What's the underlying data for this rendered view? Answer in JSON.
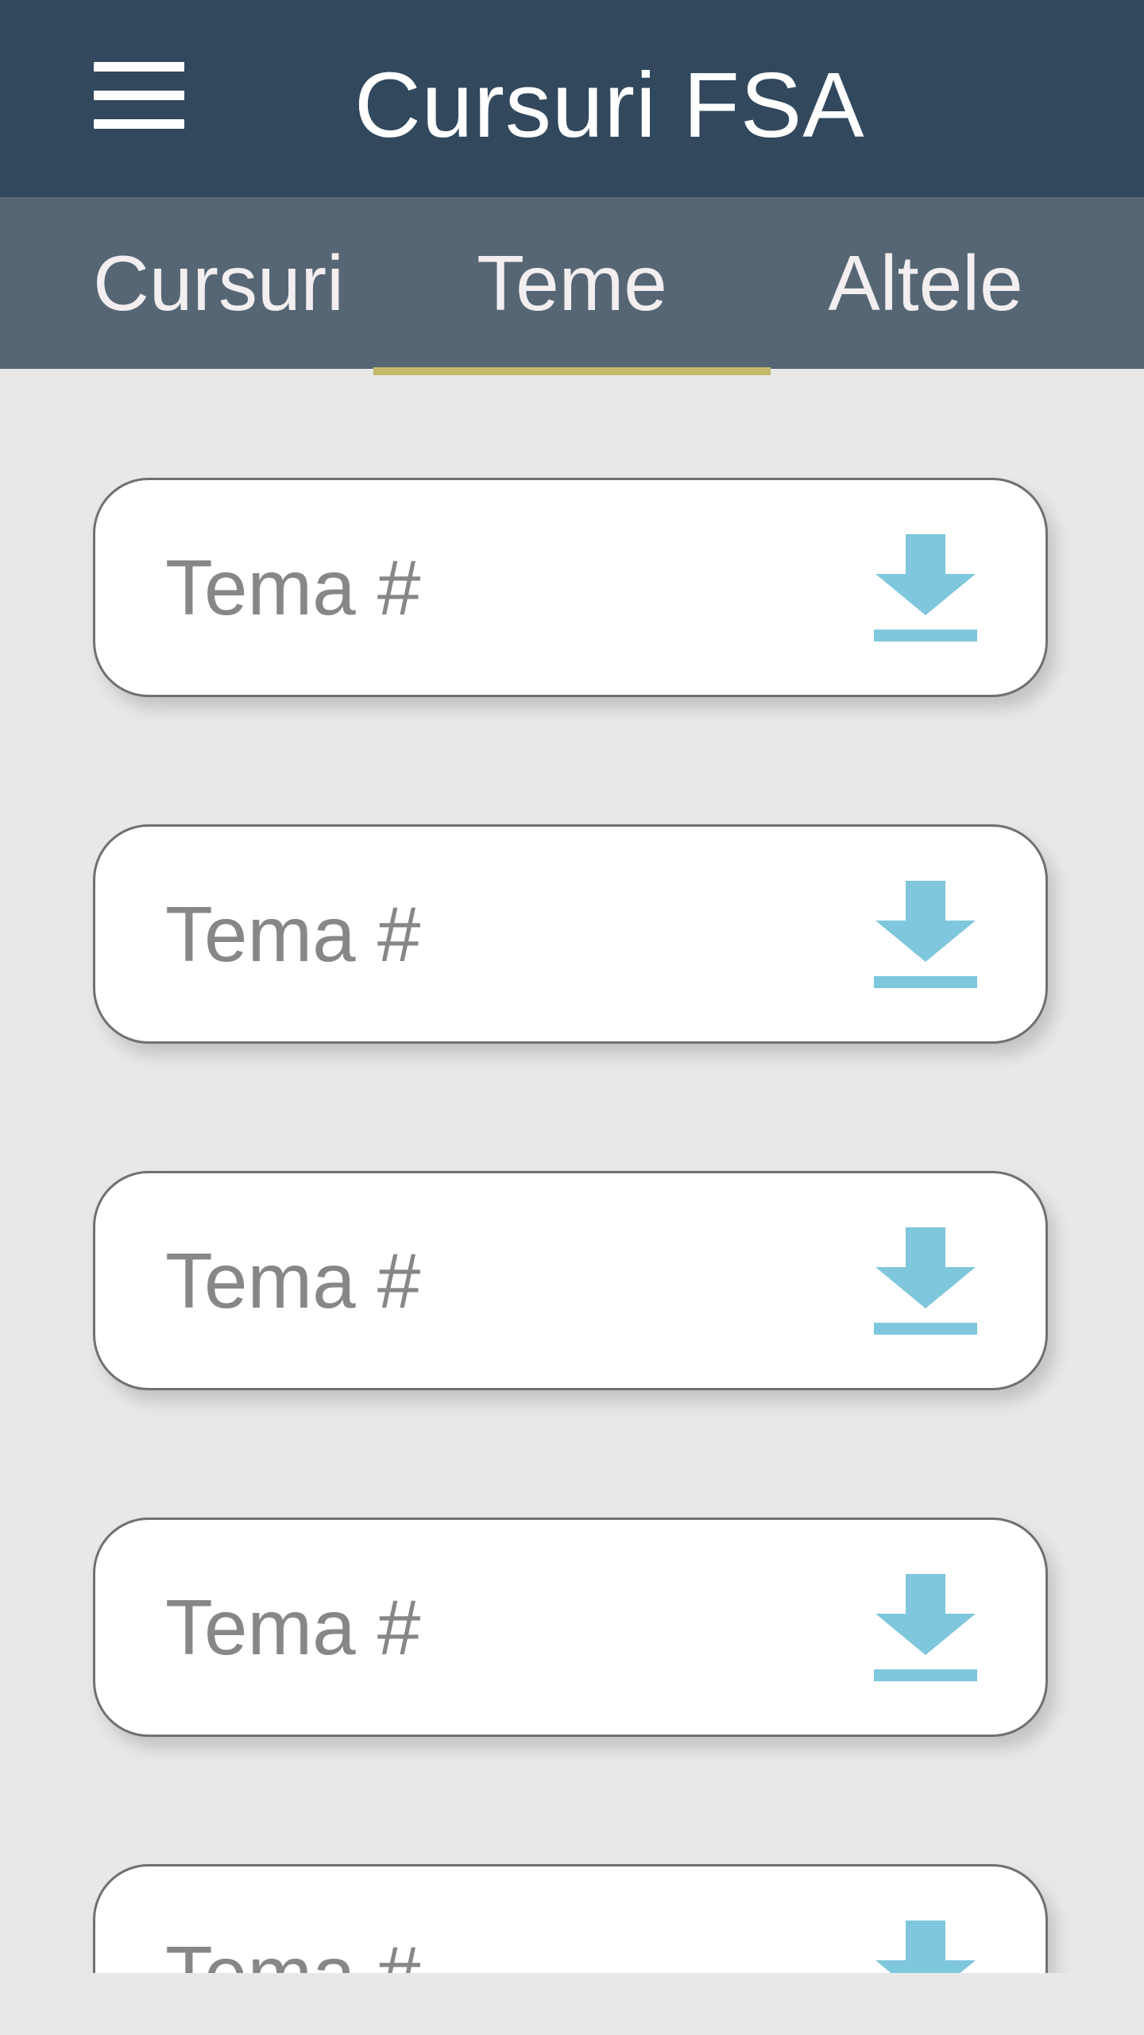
{
  "app": {
    "title": "Cursuri FSA",
    "accent_color": "#c2b96a",
    "appbar_color": "#32495d",
    "tabbar_color": "#566674"
  },
  "header": {
    "menu_icon": "hamburger-menu-icon"
  },
  "tabs": [
    {
      "label": "Cursuri",
      "selected": false
    },
    {
      "label": "Teme",
      "selected": true
    },
    {
      "label": "Altele",
      "selected": false
    }
  ],
  "items": [
    {
      "label": "Tema #",
      "icon": "download-icon"
    },
    {
      "label": "Tema #",
      "icon": "download-icon"
    },
    {
      "label": "Tema #",
      "icon": "download-icon"
    },
    {
      "label": "Tema #",
      "icon": "download-icon"
    },
    {
      "label": "Tema #",
      "icon": "download-icon"
    }
  ],
  "icon_color": "#7fc7dc"
}
